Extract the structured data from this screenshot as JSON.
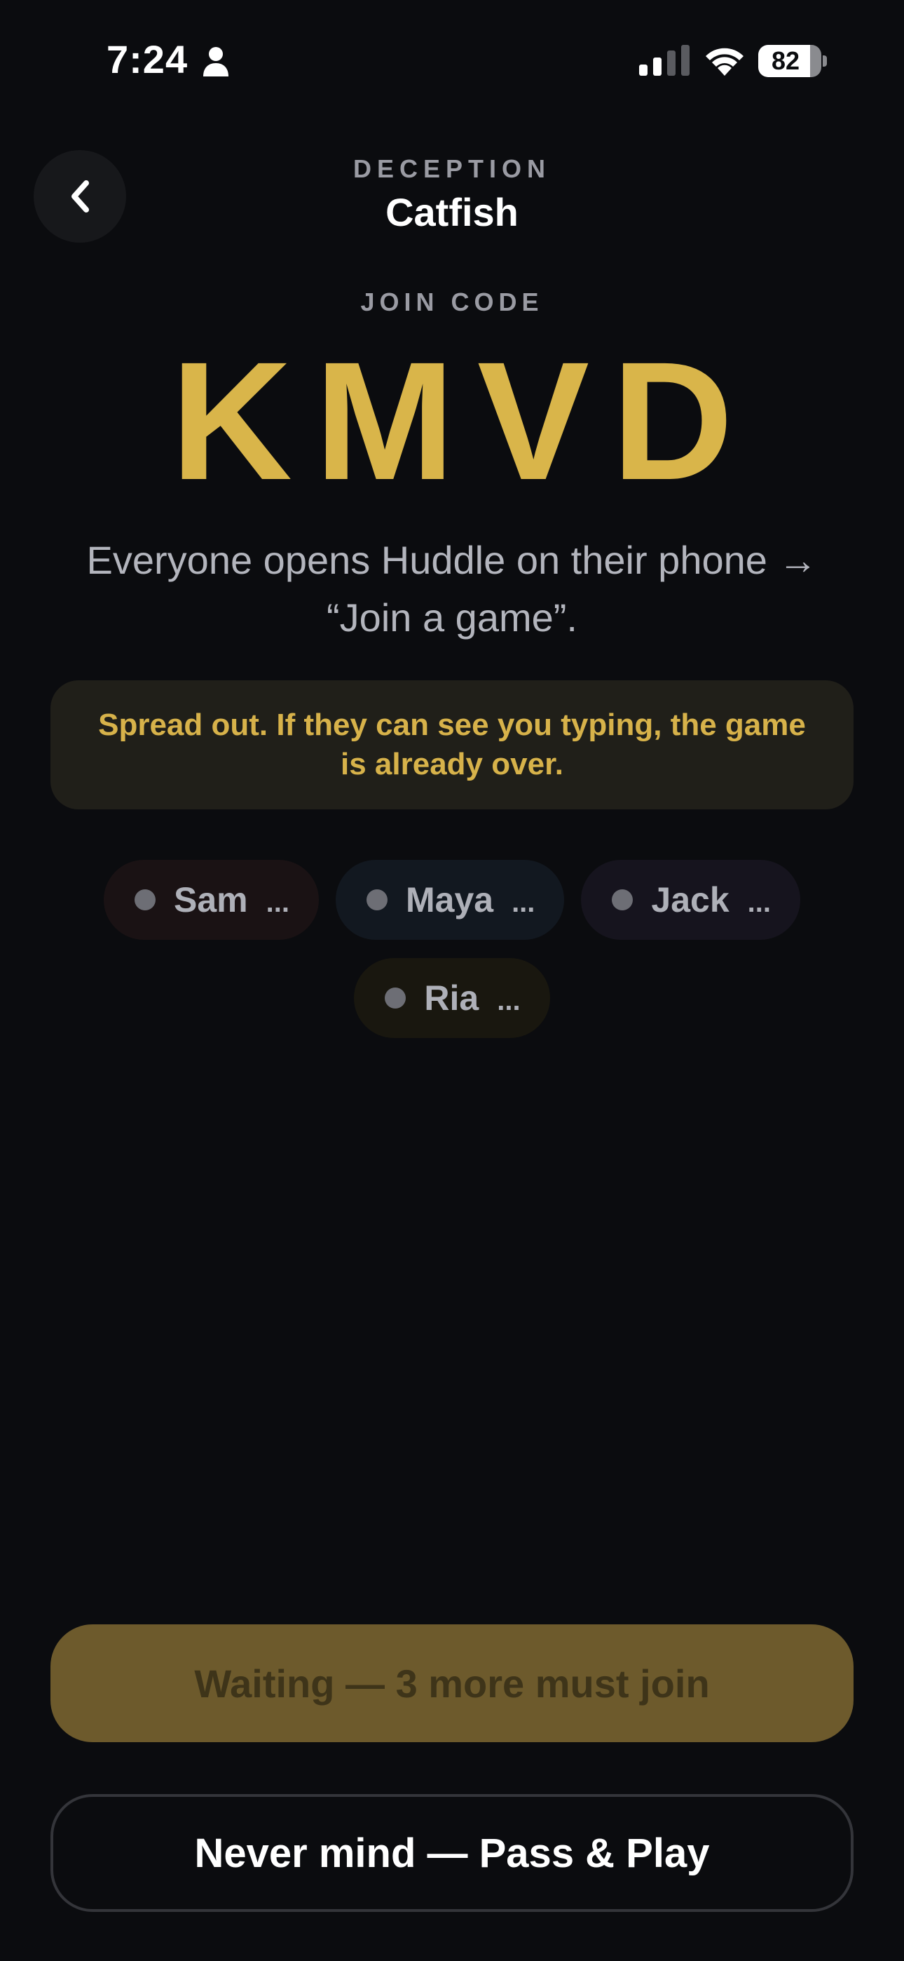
{
  "status_bar": {
    "time": "7:24",
    "battery_level": "82",
    "battery_fraction": 0.82
  },
  "header": {
    "back_icon": "chevron-left-icon",
    "category": "DECEPTION",
    "title": "Catfish"
  },
  "join": {
    "label": "JOIN CODE",
    "code": "KMVD",
    "code_color": "#d9b54a",
    "instructions": "Everyone opens Huddle on their phone → “Join a game”."
  },
  "warning": {
    "text": "Spread out. If they can see you typing, the game is already over.",
    "color": "#d7b24a"
  },
  "players": [
    {
      "name": "Sam",
      "status": "...",
      "chip_color": "#1a1214"
    },
    {
      "name": "Maya",
      "status": "...",
      "chip_color": "#121820"
    },
    {
      "name": "Jack",
      "status": "...",
      "chip_color": "#16141e"
    },
    {
      "name": "Ria",
      "status": "...",
      "chip_color": "#19170f"
    }
  ],
  "actions": {
    "waiting_label": "Waiting — 3 more must join",
    "pass_and_play_label": "Never mind — Pass & Play"
  }
}
